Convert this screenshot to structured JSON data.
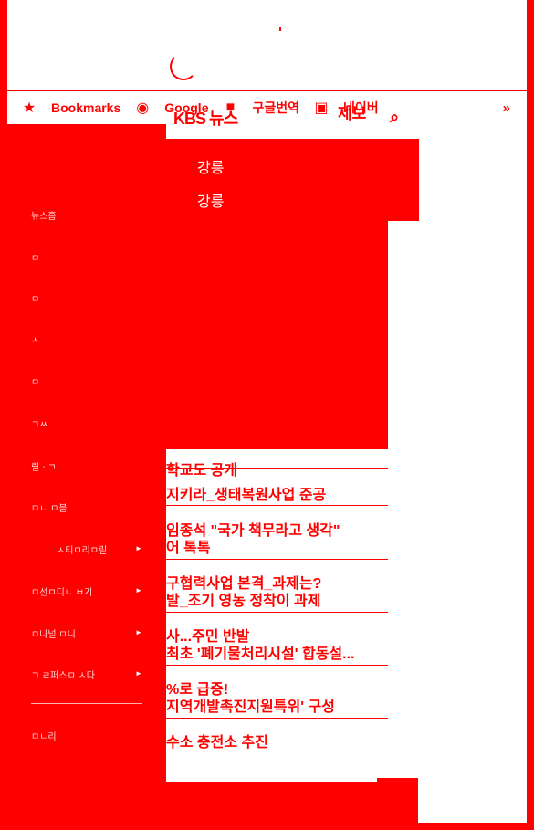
{
  "bookmarks_bar": {
    "items": [
      {
        "label": "Bookmarks",
        "icon": "star-icon"
      },
      {
        "label": "Google",
        "icon": "google-icon"
      },
      {
        "label": "구글번역",
        "icon": "folder-icon"
      },
      {
        "label": "네이버",
        "icon": "bookmark-icon"
      }
    ],
    "more": "»"
  },
  "header": {
    "logo": "KBS 뉴스",
    "tv_label": "제보"
  },
  "sections": [
    "강릉",
    "강릉"
  ],
  "sidebar": {
    "items": [
      {
        "label": "뉴스홈",
        "arrow": false
      },
      {
        "label": "ㅁ",
        "arrow": false
      },
      {
        "label": "ㅁ",
        "arrow": false
      },
      {
        "label": "ㅅ",
        "arrow": false
      },
      {
        "label": "ㅁ",
        "arrow": false
      },
      {
        "label": "ㄱㅆ",
        "arrow": false
      },
      {
        "label": "릴ㆍㄱ",
        "arrow": false
      },
      {
        "label": "ㅁㄴ ㅁ블",
        "arrow": false
      },
      {
        "label": "ㅅ티ㅁ리ㅁ릳",
        "arrow": true
      },
      {
        "label": "ㅁ선ㅁ디ㄴ ㅂ기",
        "arrow": true
      },
      {
        "label": "ㅁ나널 ㅁ니",
        "arrow": true
      },
      {
        "label": "ㄱ ㄹ퍼스ㅁ ㅅ다",
        "arrow": true
      },
      {
        "label": "ㅁㄴ리",
        "arrow": false
      }
    ]
  },
  "news": [
    "학교도 공개",
    "지키라_생태복원사업 준공",
    "임종석 \"국가 책무라고 생각\"",
    "어 톡톡",
    "구협력사업 본격_과제는?",
    "발_조기 영농 정착이 과제",
    "사...주민 반발",
    "최초 '폐기물처리시설' 합동설...",
    "%로 급증!",
    "지역개발촉진지원특위' 구성",
    "수소 충전소 추진"
  ],
  "colors": {
    "accent": "#ff0000",
    "background": "#ffffff"
  }
}
